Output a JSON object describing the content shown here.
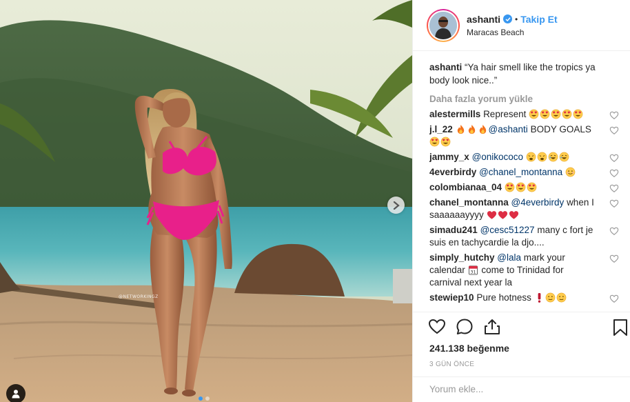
{
  "post": {
    "username": "ashanti",
    "follow_label": "Takip Et",
    "separator": "•",
    "location": "Maracas Beach",
    "caption_user": "ashanti",
    "caption_text": "“Ya hair smell like the tropics ya body look nice..”",
    "load_more": "Daha fazla yorum yükle",
    "photo_watermark": "@NETWORKINGZ",
    "likes": "241.138 beğenme",
    "time": "3 GÜN ÖNCE",
    "comment_placeholder": "Yorum ekle...",
    "carousel": {
      "count": 2,
      "active": 1
    }
  },
  "comments": [
    {
      "user": "alestermills",
      "text": "Represent",
      "emoji": [
        "heart-eyes",
        "heart-eyes",
        "heart-eyes",
        "heart-eyes",
        "heart-eyes"
      ]
    },
    {
      "user": "j.l_22",
      "pre_emoji": [
        "fire",
        "fire",
        "fire"
      ],
      "text": "BODY GOALS",
      "mention": "@ashanti",
      "emoji": [
        "heart-eyes",
        "heart-eyes"
      ]
    },
    {
      "user": "jammy_x",
      "mention": "@onikococo",
      "emoji": [
        "weary",
        "weary",
        "rolling",
        "rolling"
      ]
    },
    {
      "user": "4everbirdy",
      "mention": "@chanel_montanna",
      "emoji": [
        "smiling"
      ]
    },
    {
      "user": "colombianaa_04",
      "emoji": [
        "heart-eyes",
        "heart-eyes",
        "heart-eyes"
      ]
    },
    {
      "user": "chanel_montanna",
      "mention": "@4everbirdy",
      "text": "when I saaaaaayyyy",
      "emoji": [
        "red-heart",
        "red-heart",
        "red-heart"
      ]
    },
    {
      "user": "simadu241",
      "mention": "@cesc51227",
      "text": "many c fort je suis en tachycardie la djo...."
    },
    {
      "user": "simply_hutchy",
      "mention": "@lala",
      "text": "mark your calendar",
      "inline_emoji": "calendar",
      "text2": "come to Trinidad for carnival next year la"
    },
    {
      "user": "stewiep10",
      "text": "Pure hotness",
      "emoji": [
        "exclamation",
        "face",
        "face"
      ]
    }
  ],
  "colors": {
    "accent": "#3897f0",
    "mention": "#003569",
    "muted": "#999999",
    "bikini": "#e8208a"
  }
}
